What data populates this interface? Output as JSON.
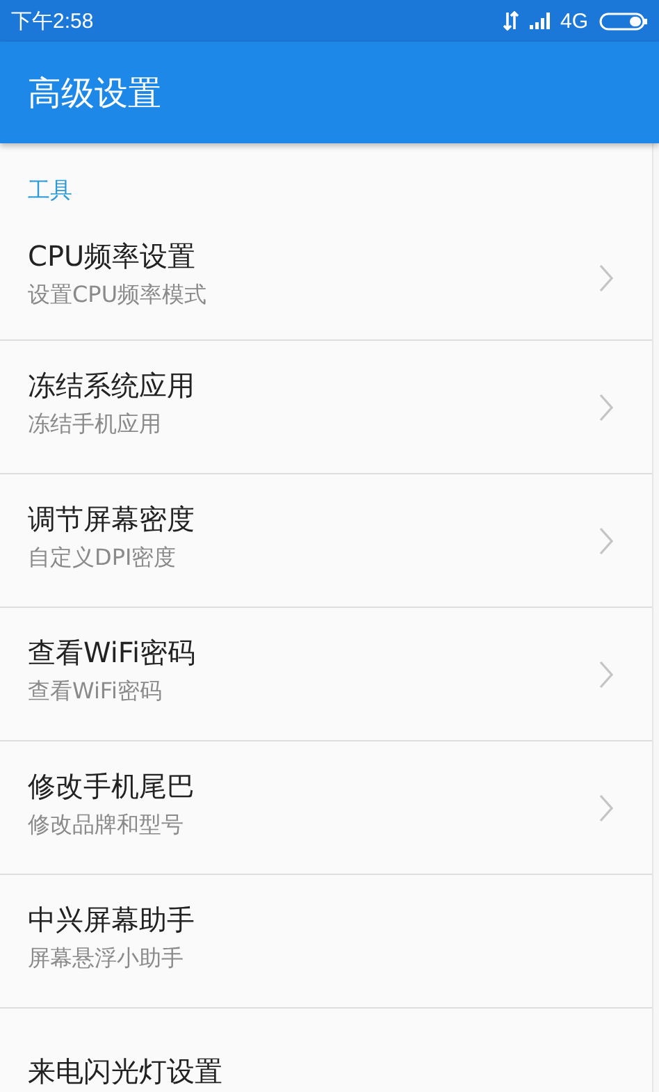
{
  "status_bar": {
    "time": "下午2:58",
    "network": "4G"
  },
  "app_bar": {
    "title": "高级设置"
  },
  "section": {
    "title": "工具"
  },
  "items": [
    {
      "title": "CPU频率设置",
      "subtitle": "设置CPU频率模式",
      "chevron": true
    },
    {
      "title": "冻结系统应用",
      "subtitle": "冻结手机应用",
      "chevron": true
    },
    {
      "title": "调节屏幕密度",
      "subtitle": "自定义DPI密度",
      "chevron": true
    },
    {
      "title": "查看WiFi密码",
      "subtitle": "查看WiFi密码",
      "chevron": true
    },
    {
      "title": "修改手机尾巴",
      "subtitle": "修改品牌和型号",
      "chevron": true
    },
    {
      "title": "中兴屏幕助手",
      "subtitle": "屏幕悬浮小助手",
      "chevron": false
    },
    {
      "title": "来电闪光灯设置",
      "chevron": false
    }
  ]
}
